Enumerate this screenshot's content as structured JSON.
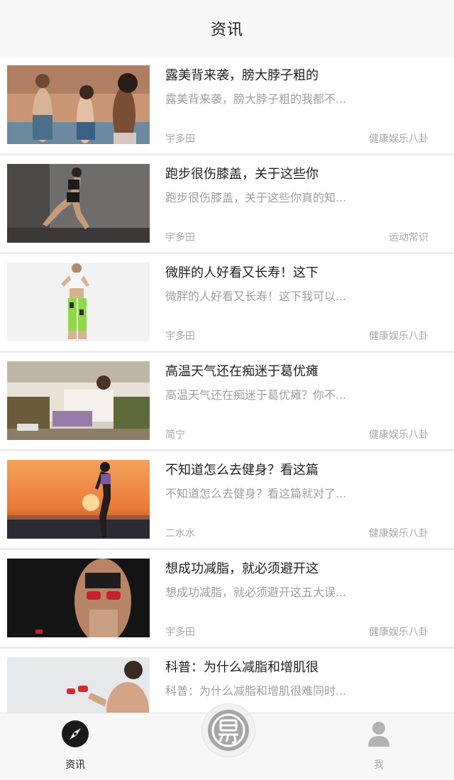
{
  "header": {
    "title": "资讯"
  },
  "articles": [
    {
      "title": "露美背来袭，膀大脖子粗的",
      "summary": "露美背来袭，膀大脖子粗的我都不...",
      "author": "宇多田",
      "category": "健康娱乐八卦"
    },
    {
      "title": "跑步很伤膝盖，关于这些你",
      "summary": "跑步很伤膝盖，关于这些你真的知...",
      "author": "宇多田",
      "category": "运动常识"
    },
    {
      "title": "微胖的人好看又长寿！这下",
      "summary": "微胖的人好看又长寿！这下我可以...",
      "author": "宇多田",
      "category": "健康娱乐八卦"
    },
    {
      "title": "高温天气还在痴迷于葛优瘫",
      "summary": "高温天气还在痴迷于葛优瘫？你不...",
      "author": "简宁",
      "category": "健康娱乐八卦"
    },
    {
      "title": "不知道怎么去健身？看这篇",
      "summary": "不知道怎么去健身？看这篇就对了...",
      "author": "二水水",
      "category": "健康娱乐八卦"
    },
    {
      "title": "想成功减脂，就必须避开这",
      "summary": "想成功减脂，就必须避开这五大误...",
      "author": "宇多田",
      "category": "健康娱乐八卦"
    },
    {
      "title": "科普：为什么减脂和增肌很",
      "summary": "科普：为什么减脂和增肌很难同时...",
      "author": "",
      "category": ""
    }
  ],
  "tabbar": {
    "tabs": [
      {
        "label": "资讯",
        "icon": "compass-icon",
        "active": true
      },
      {
        "label": "我",
        "icon": "person-icon",
        "active": false
      }
    ],
    "center_icon": "app-logo-icon"
  },
  "colors": {
    "active_tab": "#222222",
    "inactive_tab": "#aaaaaa",
    "summary_text": "#a0a0a0"
  }
}
